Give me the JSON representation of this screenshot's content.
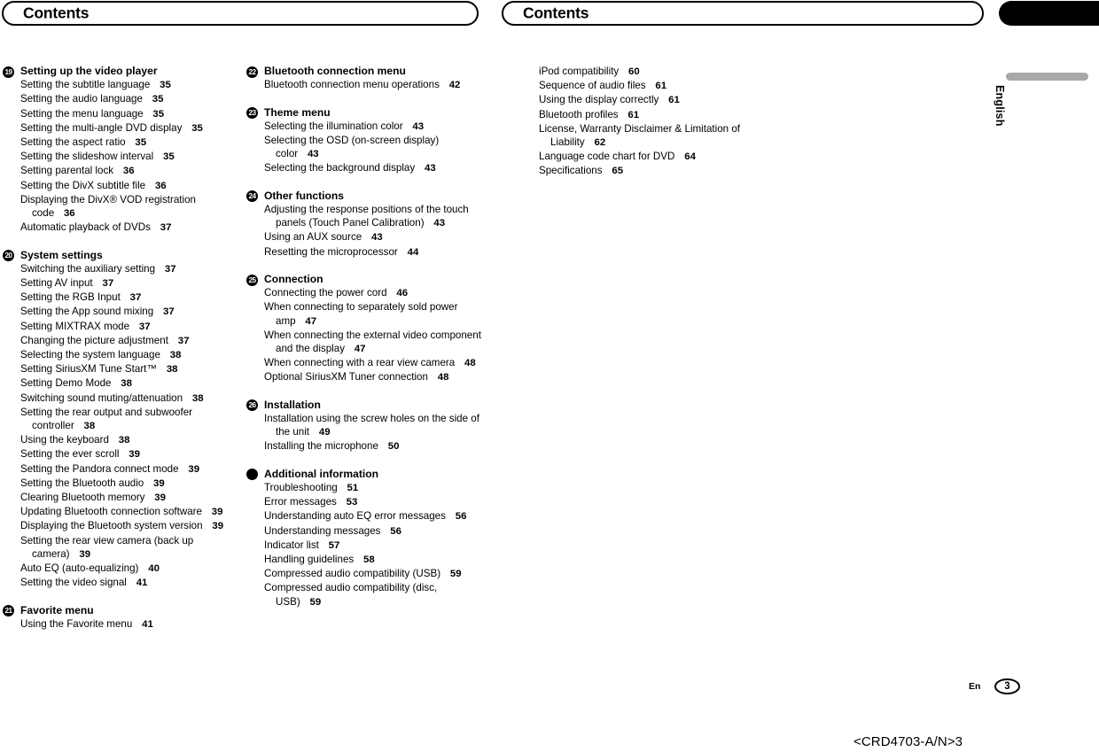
{
  "headers": {
    "left_title": "Contents",
    "right_title": "Contents"
  },
  "language_tab": {
    "label": "English"
  },
  "footer": {
    "locale_code": "En",
    "page_number": "3",
    "doc_code": "<CRD4703-A/N>3"
  },
  "columns": [
    {
      "id": "column-1",
      "sections": [
        {
          "badge": "19",
          "title": "Setting up the video player",
          "entries": [
            {
              "text": "Setting the subtitle language",
              "page": "35"
            },
            {
              "text": "Setting the audio language",
              "page": "35"
            },
            {
              "text": "Setting the menu language",
              "page": "35"
            },
            {
              "text": "Setting the multi-angle DVD display",
              "page": "35"
            },
            {
              "text": "Setting the aspect ratio",
              "page": "35"
            },
            {
              "text": "Setting the slideshow interval",
              "page": "35"
            },
            {
              "text": "Setting parental lock",
              "page": "36"
            },
            {
              "text": "Setting the DivX subtitle file",
              "page": "36"
            },
            {
              "text": "Displaying the DivX® VOD registration code",
              "page": "36"
            },
            {
              "text": "Automatic playback of DVDs",
              "page": "37"
            }
          ]
        },
        {
          "badge": "20",
          "title": "System settings",
          "entries": [
            {
              "text": "Switching the auxiliary setting",
              "page": "37"
            },
            {
              "text": "Setting AV input",
              "page": "37"
            },
            {
              "text": "Setting the RGB Input",
              "page": "37"
            },
            {
              "text": "Setting the App sound mixing",
              "page": "37"
            },
            {
              "text": "Setting MIXTRAX mode",
              "page": "37"
            },
            {
              "text": "Changing the picture adjustment",
              "page": "37"
            },
            {
              "text": "Selecting the system language",
              "page": "38"
            },
            {
              "text": "Setting SiriusXM Tune Start™",
              "page": "38"
            },
            {
              "text": "Setting Demo Mode",
              "page": "38"
            },
            {
              "text": "Switching sound muting/attenuation",
              "page": "38"
            },
            {
              "text": "Setting the rear output and subwoofer controller",
              "page": "38"
            },
            {
              "text": "Using the keyboard",
              "page": "38"
            },
            {
              "text": "Setting the ever scroll",
              "page": "39"
            },
            {
              "text": "Setting the Pandora connect mode",
              "page": "39"
            },
            {
              "text": "Setting the Bluetooth audio",
              "page": "39"
            },
            {
              "text": "Clearing Bluetooth memory",
              "page": "39"
            },
            {
              "text": "Updating Bluetooth connection software",
              "page": "39"
            },
            {
              "text": "Displaying the Bluetooth system version",
              "page": "39"
            },
            {
              "text": "Setting the rear view camera (back up camera)",
              "page": "39"
            },
            {
              "text": "Auto EQ (auto-equalizing)",
              "page": "40"
            },
            {
              "text": "Setting the video signal",
              "page": "41"
            }
          ]
        },
        {
          "badge": "21",
          "title": "Favorite menu",
          "entries": [
            {
              "text": "Using the Favorite menu",
              "page": "41"
            }
          ]
        }
      ]
    },
    {
      "id": "column-2",
      "sections": [
        {
          "badge": "22",
          "title": "Bluetooth connection menu",
          "entries": [
            {
              "text": "Bluetooth connection menu operations",
              "page": "42"
            }
          ]
        },
        {
          "badge": "23",
          "title": "Theme menu",
          "entries": [
            {
              "text": "Selecting the illumination color",
              "page": "43"
            },
            {
              "text": "Selecting the OSD (on-screen display) color",
              "page": "43"
            },
            {
              "text": "Selecting the background display",
              "page": "43"
            }
          ]
        },
        {
          "badge": "24",
          "title": "Other functions",
          "entries": [
            {
              "text": "Adjusting the response positions of the touch panels (Touch Panel Calibration)",
              "page": "43"
            },
            {
              "text": "Using an AUX source",
              "page": "43"
            },
            {
              "text": "Resetting the microprocessor",
              "page": "44"
            }
          ]
        },
        {
          "badge": "25",
          "title": "Connection",
          "entries": [
            {
              "text": "Connecting the power cord",
              "page": "46"
            },
            {
              "text": "When connecting to separately sold power amp",
              "page": "47"
            },
            {
              "text": "When connecting the external video component and the display",
              "page": "47"
            },
            {
              "text": "When connecting with a rear view camera",
              "page": "48"
            },
            {
              "text": "Optional SiriusXM Tuner connection",
              "page": "48"
            }
          ]
        },
        {
          "badge": "26",
          "title": "Installation",
          "entries": [
            {
              "text": "Installation using the screw holes on the side of the unit",
              "page": "49"
            },
            {
              "text": "Installing the microphone",
              "page": "50"
            }
          ]
        },
        {
          "badge": "",
          "title": "Additional information",
          "entries": [
            {
              "text": "Troubleshooting",
              "page": "51"
            },
            {
              "text": "Error messages",
              "page": "53"
            },
            {
              "text": "Understanding auto EQ error messages",
              "page": "56"
            },
            {
              "text": "Understanding messages",
              "page": "56"
            },
            {
              "text": "Indicator list",
              "page": "57"
            },
            {
              "text": "Handling guidelines",
              "page": "58"
            },
            {
              "text": "Compressed audio compatibility (USB)",
              "page": "59"
            },
            {
              "text": "Compressed audio compatibility (disc, USB)",
              "page": "59"
            }
          ]
        }
      ]
    },
    {
      "id": "column-3",
      "sections": [
        {
          "badge": null,
          "title": null,
          "entries": [
            {
              "text": "iPod compatibility",
              "page": "60"
            },
            {
              "text": "Sequence of audio files",
              "page": "61"
            },
            {
              "text": "Using the display correctly",
              "page": "61"
            },
            {
              "text": "Bluetooth profiles",
              "page": "61"
            },
            {
              "text": "License, Warranty Disclaimer & Limitation of Liability",
              "page": "62"
            },
            {
              "text": "Language code chart for DVD",
              "page": "64"
            },
            {
              "text": "Specifications",
              "page": "65"
            }
          ]
        }
      ]
    }
  ]
}
